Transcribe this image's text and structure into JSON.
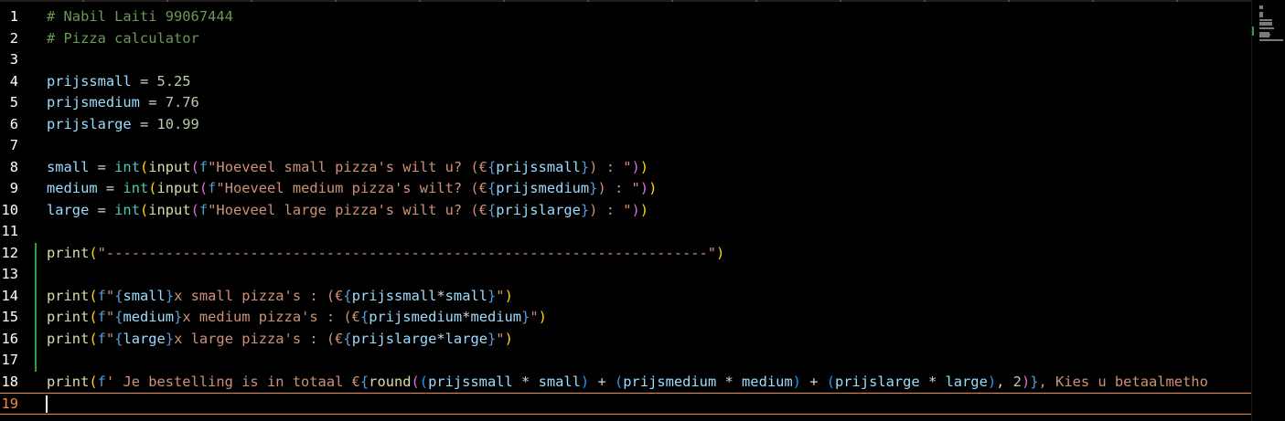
{
  "editor": {
    "lines": [
      {
        "n": "1",
        "tokens": [
          [
            "c",
            "# Nabil Laiti 99067444"
          ]
        ]
      },
      {
        "n": "2",
        "tokens": [
          [
            "c",
            "# Pizza calculator"
          ]
        ]
      },
      {
        "n": "3",
        "tokens": []
      },
      {
        "n": "4",
        "tokens": [
          [
            "v",
            "prijssmall"
          ],
          [
            "o",
            " = "
          ],
          [
            "n",
            "5.25"
          ]
        ]
      },
      {
        "n": "5",
        "tokens": [
          [
            "v",
            "prijsmedium"
          ],
          [
            "o",
            " = "
          ],
          [
            "n",
            "7.76"
          ]
        ]
      },
      {
        "n": "6",
        "tokens": [
          [
            "v",
            "prijslarge"
          ],
          [
            "o",
            " = "
          ],
          [
            "n",
            "10.99"
          ]
        ]
      },
      {
        "n": "7",
        "tokens": []
      },
      {
        "n": "8",
        "tokens": [
          [
            "v",
            "small"
          ],
          [
            "o",
            " = "
          ],
          [
            "b",
            "int"
          ],
          [
            "p1",
            "("
          ],
          [
            "f",
            "input"
          ],
          [
            "p2",
            "("
          ],
          [
            "fp",
            "f"
          ],
          [
            "s",
            "\"Hoeveel small pizza's wilt u? (€"
          ],
          [
            "brace",
            "{"
          ],
          [
            "v",
            "prijssmall"
          ],
          [
            "brace",
            "}"
          ],
          [
            "s",
            ") : \""
          ],
          [
            "p2",
            ")"
          ],
          [
            "p1",
            ")"
          ]
        ]
      },
      {
        "n": "9",
        "tokens": [
          [
            "v",
            "medium"
          ],
          [
            "o",
            " = "
          ],
          [
            "b",
            "int"
          ],
          [
            "p1",
            "("
          ],
          [
            "f",
            "input"
          ],
          [
            "p2",
            "("
          ],
          [
            "fp",
            "f"
          ],
          [
            "s",
            "\"Hoeveel medium pizza's wilt? (€"
          ],
          [
            "brace",
            "{"
          ],
          [
            "v",
            "prijsmedium"
          ],
          [
            "brace",
            "}"
          ],
          [
            "s",
            ") : \""
          ],
          [
            "p2",
            ")"
          ],
          [
            "p1",
            ")"
          ]
        ]
      },
      {
        "n": "10",
        "tokens": [
          [
            "v",
            "large"
          ],
          [
            "o",
            " = "
          ],
          [
            "b",
            "int"
          ],
          [
            "p1",
            "("
          ],
          [
            "f",
            "input"
          ],
          [
            "p2",
            "("
          ],
          [
            "fp",
            "f"
          ],
          [
            "s",
            "\"Hoeveel large pizza's wilt u? (€"
          ],
          [
            "brace",
            "{"
          ],
          [
            "v",
            "prijslarge"
          ],
          [
            "brace",
            "}"
          ],
          [
            "s",
            ") : \""
          ],
          [
            "p2",
            ")"
          ],
          [
            "p1",
            ")"
          ]
        ]
      },
      {
        "n": "11",
        "tokens": []
      },
      {
        "n": "12",
        "mark": true,
        "tokens": [
          [
            "f",
            "print"
          ],
          [
            "p1",
            "("
          ],
          [
            "s",
            "\"-----------------------------------------------------------------------\""
          ],
          [
            "p1",
            ")"
          ]
        ]
      },
      {
        "n": "13",
        "mark": true,
        "tokens": []
      },
      {
        "n": "14",
        "mark": true,
        "tokens": [
          [
            "f",
            "print"
          ],
          [
            "p1",
            "("
          ],
          [
            "fp",
            "f"
          ],
          [
            "s",
            "\""
          ],
          [
            "brace",
            "{"
          ],
          [
            "v",
            "small"
          ],
          [
            "brace",
            "}"
          ],
          [
            "s",
            "x small pizza's : (€"
          ],
          [
            "brace",
            "{"
          ],
          [
            "v",
            "prijssmall"
          ],
          [
            "o",
            "*"
          ],
          [
            "v",
            "small"
          ],
          [
            "brace",
            "}"
          ],
          [
            "s",
            "\""
          ],
          [
            "p1",
            ")"
          ]
        ]
      },
      {
        "n": "15",
        "mark": true,
        "tokens": [
          [
            "f",
            "print"
          ],
          [
            "p1",
            "("
          ],
          [
            "fp",
            "f"
          ],
          [
            "s",
            "\""
          ],
          [
            "brace",
            "{"
          ],
          [
            "v",
            "medium"
          ],
          [
            "brace",
            "}"
          ],
          [
            "s",
            "x medium pizza's : (€"
          ],
          [
            "brace",
            "{"
          ],
          [
            "v",
            "prijsmedium"
          ],
          [
            "o",
            "*"
          ],
          [
            "v",
            "medium"
          ],
          [
            "brace",
            "}"
          ],
          [
            "s",
            "\""
          ],
          [
            "p1",
            ")"
          ]
        ]
      },
      {
        "n": "16",
        "mark": true,
        "tokens": [
          [
            "f",
            "print"
          ],
          [
            "p1",
            "("
          ],
          [
            "fp",
            "f"
          ],
          [
            "s",
            "\""
          ],
          [
            "brace",
            "{"
          ],
          [
            "v",
            "large"
          ],
          [
            "brace",
            "}"
          ],
          [
            "s",
            "x large pizza's : (€"
          ],
          [
            "brace",
            "{"
          ],
          [
            "v",
            "prijslarge"
          ],
          [
            "o",
            "*"
          ],
          [
            "v",
            "large"
          ],
          [
            "brace",
            "}"
          ],
          [
            "s",
            "\""
          ],
          [
            "p1",
            ")"
          ]
        ]
      },
      {
        "n": "17",
        "mark": true,
        "tokens": []
      },
      {
        "n": "18",
        "tokens": [
          [
            "f",
            "print"
          ],
          [
            "p1",
            "("
          ],
          [
            "fp",
            "f"
          ],
          [
            "s",
            "' Je bestelling is in totaal €"
          ],
          [
            "brace",
            "{"
          ],
          [
            "f",
            "round"
          ],
          [
            "p2",
            "("
          ],
          [
            "p3",
            "("
          ],
          [
            "v",
            "prijssmall"
          ],
          [
            "o",
            " * "
          ],
          [
            "v",
            "small"
          ],
          [
            "p3",
            ")"
          ],
          [
            "o",
            " + "
          ],
          [
            "p3",
            "("
          ],
          [
            "v",
            "prijsmedium"
          ],
          [
            "o",
            " * "
          ],
          [
            "v",
            "medium"
          ],
          [
            "p3",
            ")"
          ],
          [
            "o",
            " + "
          ],
          [
            "p3",
            "("
          ],
          [
            "v",
            "prijslarge"
          ],
          [
            "o",
            " * "
          ],
          [
            "v",
            "large"
          ],
          [
            "p3",
            ")"
          ],
          [
            "o",
            ", "
          ],
          [
            "n",
            "2"
          ],
          [
            "p2",
            ")"
          ],
          [
            "brace",
            "}"
          ],
          [
            "s",
            ", Kies u betaalmetho"
          ]
        ]
      },
      {
        "n": "19",
        "current": true,
        "tokens": []
      }
    ]
  },
  "colors": {
    "background": "#000000",
    "comment": "#6a9955",
    "variable": "#9cdcfe",
    "string": "#ce9178",
    "number": "#b5cea8",
    "function": "#dcdcaa",
    "builtin": "#4ec9b0",
    "gutter_modified": "#2ea043",
    "current_line_border": "#f0883e"
  }
}
